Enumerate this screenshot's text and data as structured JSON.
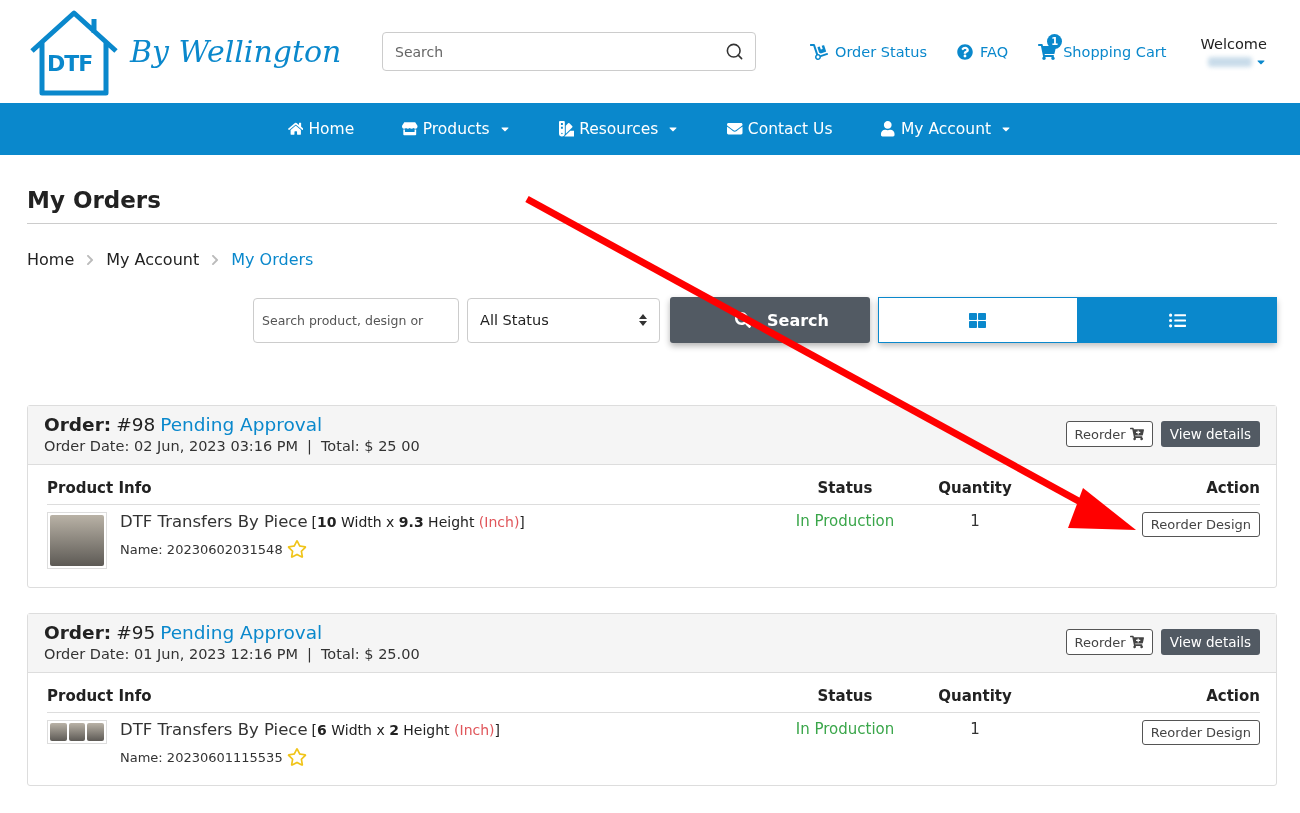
{
  "header": {
    "logo_mark": "DTF",
    "logo_text": "By Wellington",
    "search": {
      "placeholder": "Search"
    },
    "links": [
      {
        "kind": "status",
        "label": "Order Status"
      },
      {
        "kind": "faq",
        "label": "FAQ"
      },
      {
        "kind": "cart",
        "label": "Shopping Cart",
        "badge": "1"
      }
    ],
    "welcome": "Welcome"
  },
  "nav": [
    {
      "kind": "home",
      "label": "Home",
      "dropdown": false
    },
    {
      "kind": "store",
      "label": "Products",
      "dropdown": true
    },
    {
      "kind": "resources",
      "label": "Resources",
      "dropdown": true
    },
    {
      "kind": "mail",
      "label": "Contact Us",
      "dropdown": false
    },
    {
      "kind": "user",
      "label": "My Account",
      "dropdown": true
    }
  ],
  "page_title": "My Orders",
  "breadcrumb": [
    {
      "label": "Home",
      "selected": false
    },
    {
      "label": "My Account",
      "selected": false
    },
    {
      "label": "My Orders",
      "selected": true
    }
  ],
  "filters": {
    "search": {
      "placeholder": "Search product, design or"
    },
    "status": "All Status",
    "search_button": "Search",
    "views": [
      {
        "kind": "grid",
        "selected": false
      },
      {
        "kind": "list",
        "selected": true
      }
    ]
  },
  "orders": [
    {
      "label": "Order:",
      "number": "#98",
      "status": "Pending Approval",
      "date": "Order Date: 02 Jun, 2023 03:16 PM",
      "separator": "|",
      "total": "Total: $ 25 00",
      "reorder": "Reorder",
      "details": "View details",
      "columns": [
        "Product Info",
        "Status",
        "Quantity",
        "Action"
      ],
      "items": [
        {
          "kind": "single",
          "title": "DTF Transfers By Piece",
          "size": "[**10** Width x **9.3** Height",
          "unit": "(Inch)",
          "close": "]",
          "name": "Name: 20230602031548",
          "status": "In Production",
          "quantity": "1",
          "action": "Reorder Design"
        }
      ]
    },
    {
      "label": "Order:",
      "number": "#95",
      "status": "Pending Approval",
      "date": "Order Date: 01 Jun, 2023 12:16 PM",
      "separator": "|",
      "total": "Total: $ 25.00",
      "reorder": "Reorder",
      "details": "View details",
      "columns": [
        "Product Info",
        "Status",
        "Quantity",
        "Action"
      ],
      "items": [
        {
          "kind": "row",
          "title": "DTF Transfers By Piece",
          "size": "[**6** Width x **2** Height",
          "unit": "(Inch)",
          "close": "]",
          "name": "Name: 20230601115535",
          "status": "In Production",
          "quantity": "1",
          "action": "Reorder Design"
        }
      ]
    }
  ]
}
